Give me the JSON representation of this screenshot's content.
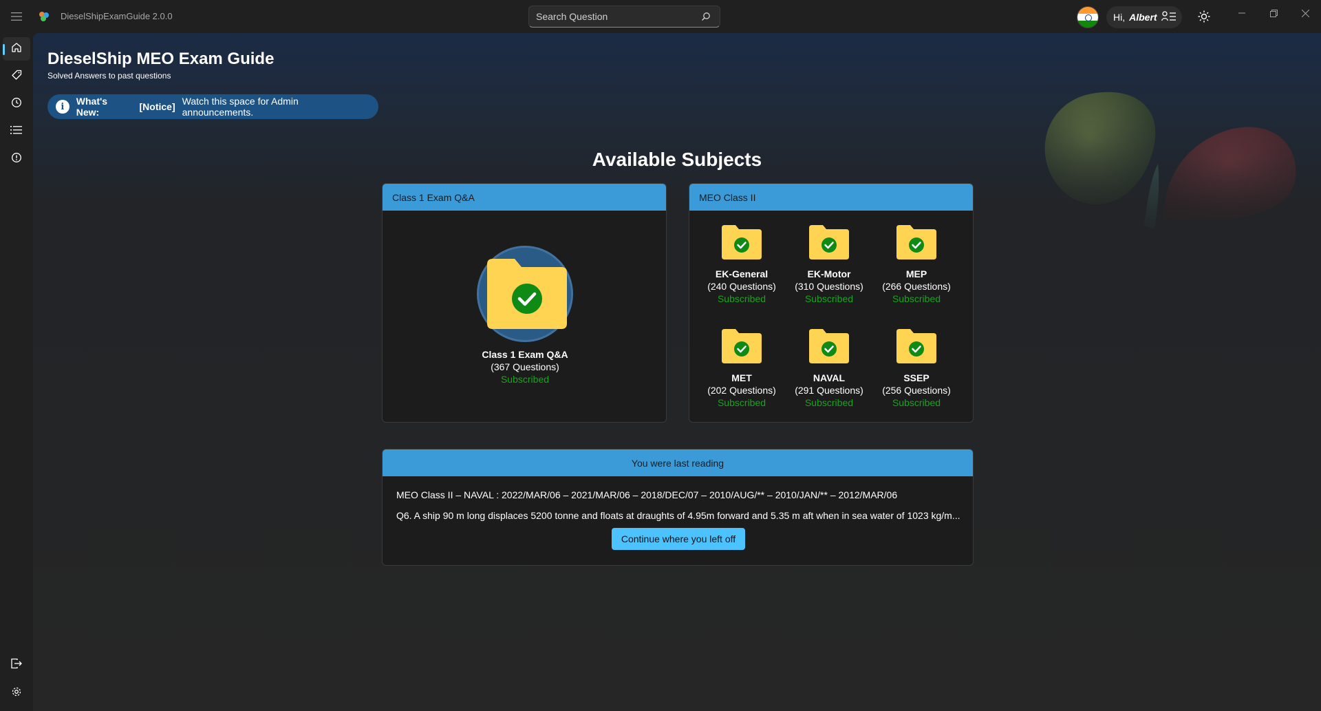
{
  "app": {
    "title": "DieselShipExamGuide 2.0.0"
  },
  "search": {
    "placeholder": "Search Question"
  },
  "user": {
    "greeting": "Hi,",
    "name": "Albert"
  },
  "page": {
    "title": "DieselShip MEO Exam Guide",
    "subtitle": "Solved Answers to past questions"
  },
  "notice": {
    "label": "What's New:",
    "tag": "[Notice]",
    "text": "Watch this space for Admin announcements."
  },
  "section_title": "Available Subjects",
  "class1": {
    "header": "Class 1 Exam Q&A",
    "subject": {
      "name": "Class 1 Exam Q&A",
      "count": "(367 Questions)",
      "status": "Subscribed"
    }
  },
  "class2": {
    "header": "MEO Class II",
    "subjects": [
      {
        "name": "EK-General",
        "count": "(240 Questions)",
        "status": "Subscribed"
      },
      {
        "name": "EK-Motor",
        "count": "(310 Questions)",
        "status": "Subscribed"
      },
      {
        "name": "MEP",
        "count": "(266 Questions)",
        "status": "Subscribed"
      },
      {
        "name": "MET",
        "count": "(202 Questions)",
        "status": "Subscribed"
      },
      {
        "name": "NAVAL",
        "count": "(291 Questions)",
        "status": "Subscribed"
      },
      {
        "name": "SSEP",
        "count": "(256 Questions)",
        "status": "Subscribed"
      }
    ]
  },
  "last_reading": {
    "header": "You were last reading",
    "line1": "MEO Class II – NAVAL : 2022/MAR/06 – 2021/MAR/06 – 2018/DEC/07 – 2010/AUG/** – 2010/JAN/** – 2012/MAR/06",
    "line2": "Q6. A ship 90 m long displaces 5200 tonne and floats at draughts of 4.95m forward and 5.35 m aft when in sea water of 1023 kg/m...",
    "button": "Continue where you left off"
  },
  "colors": {
    "accent": "#4cc2ff",
    "card_header": "#3b9bd9",
    "folder": "#ffd453",
    "check": "#0f8a14",
    "subscribed": "#15a61a",
    "notice_bg": "#1d5384"
  },
  "icons": {
    "nav": [
      "home-icon",
      "tag-icon",
      "history-icon",
      "list-icon",
      "info-icon"
    ],
    "nav_bottom": [
      "logout-icon",
      "settings-icon"
    ]
  }
}
